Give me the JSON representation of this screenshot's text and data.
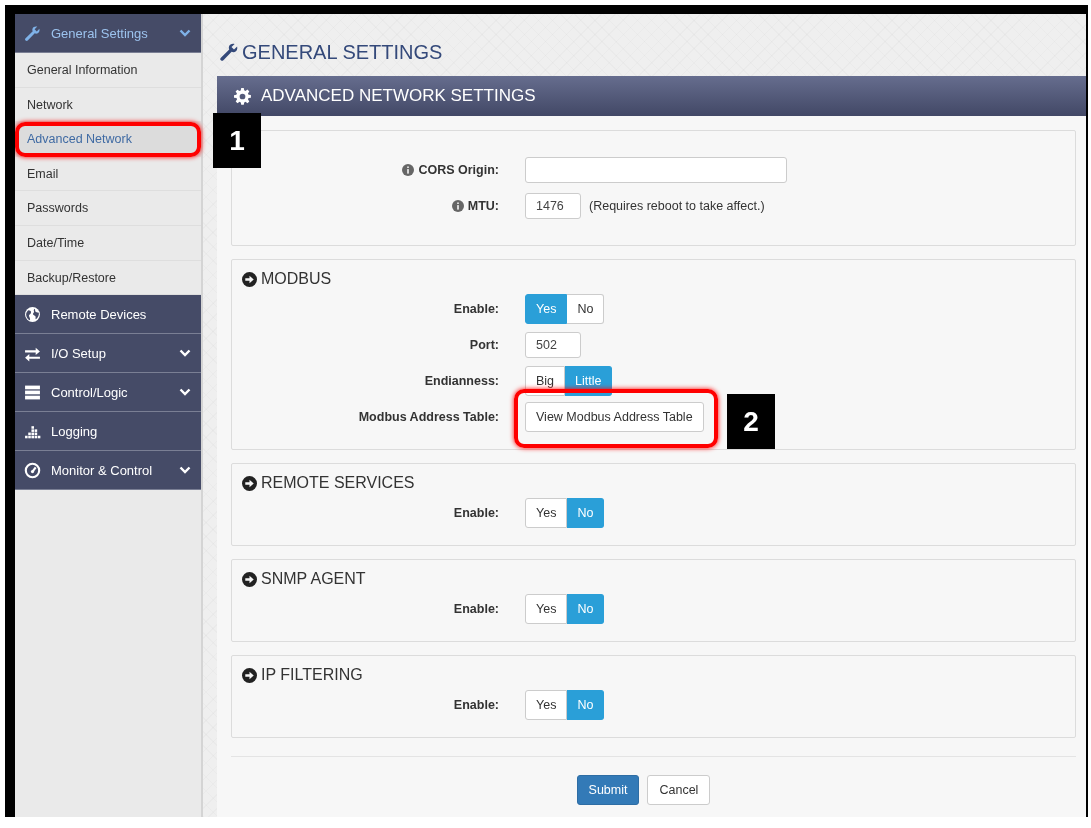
{
  "sidebar": {
    "items": [
      {
        "label": "General Settings",
        "expandable": true,
        "expanded": true,
        "children": [
          {
            "label": "General Information",
            "selected": false
          },
          {
            "label": "Network",
            "selected": false
          },
          {
            "label": "Advanced Network",
            "selected": true
          },
          {
            "label": "Email",
            "selected": false
          },
          {
            "label": "Passwords",
            "selected": false
          },
          {
            "label": "Date/Time",
            "selected": false
          },
          {
            "label": "Backup/Restore",
            "selected": false
          }
        ]
      },
      {
        "label": "Remote Devices",
        "expandable": false,
        "expanded": false
      },
      {
        "label": "I/O Setup",
        "expandable": true,
        "expanded": false
      },
      {
        "label": "Control/Logic",
        "expandable": true,
        "expanded": false
      },
      {
        "label": "Logging",
        "expandable": false,
        "expanded": false
      },
      {
        "label": "Monitor & Control",
        "expandable": true,
        "expanded": false
      }
    ]
  },
  "page_title": "GENERAL SETTINGS",
  "panel": {
    "title": "ADVANCED NETWORK SETTINGS",
    "sections": [
      {
        "fields": [
          {
            "kind": "text",
            "label": "CORS Origin:",
            "info": true
          },
          {
            "kind": "short",
            "label": "MTU:",
            "info": true,
            "value": "1476",
            "note": "(Requires reboot to take affect.)"
          }
        ]
      },
      {
        "title": "MODBUS",
        "fields": [
          {
            "kind": "toggle",
            "label": "Enable:",
            "info": false,
            "options": [
              {
                "label": "Yes",
                "selected": true
              },
              {
                "label": "No",
                "selected": false
              }
            ]
          },
          {
            "kind": "short",
            "label": "Port:",
            "info": false,
            "value": "502"
          },
          {
            "kind": "toggle",
            "label": "Endianness:",
            "info": false,
            "options": [
              {
                "label": "Big",
                "selected": false
              },
              {
                "label": "Little",
                "selected": true
              }
            ]
          },
          {
            "kind": "button",
            "label": "Modbus Address Table:",
            "info": false,
            "button": "View Modbus Address Table"
          }
        ]
      },
      {
        "title": "REMOTE SERVICES",
        "fields": [
          {
            "kind": "toggle",
            "label": "Enable:",
            "info": false,
            "options": [
              {
                "label": "Yes",
                "selected": false
              },
              {
                "label": "No",
                "selected": true
              }
            ]
          }
        ]
      },
      {
        "title": "SNMP AGENT",
        "fields": [
          {
            "kind": "toggle",
            "label": "Enable:",
            "info": false,
            "options": [
              {
                "label": "Yes",
                "selected": false
              },
              {
                "label": "No",
                "selected": true
              }
            ]
          }
        ]
      },
      {
        "title": "IP FILTERING",
        "fields": [
          {
            "kind": "toggle",
            "label": "Enable:",
            "info": false,
            "options": [
              {
                "label": "Yes",
                "selected": false
              },
              {
                "label": "No",
                "selected": true
              }
            ]
          }
        ]
      }
    ],
    "buttons": [
      {
        "label": "Submit",
        "kind": "primary"
      },
      {
        "label": "Cancel",
        "kind": "default"
      }
    ]
  },
  "callouts": [
    {
      "label": "1"
    },
    {
      "label": "2"
    }
  ]
}
